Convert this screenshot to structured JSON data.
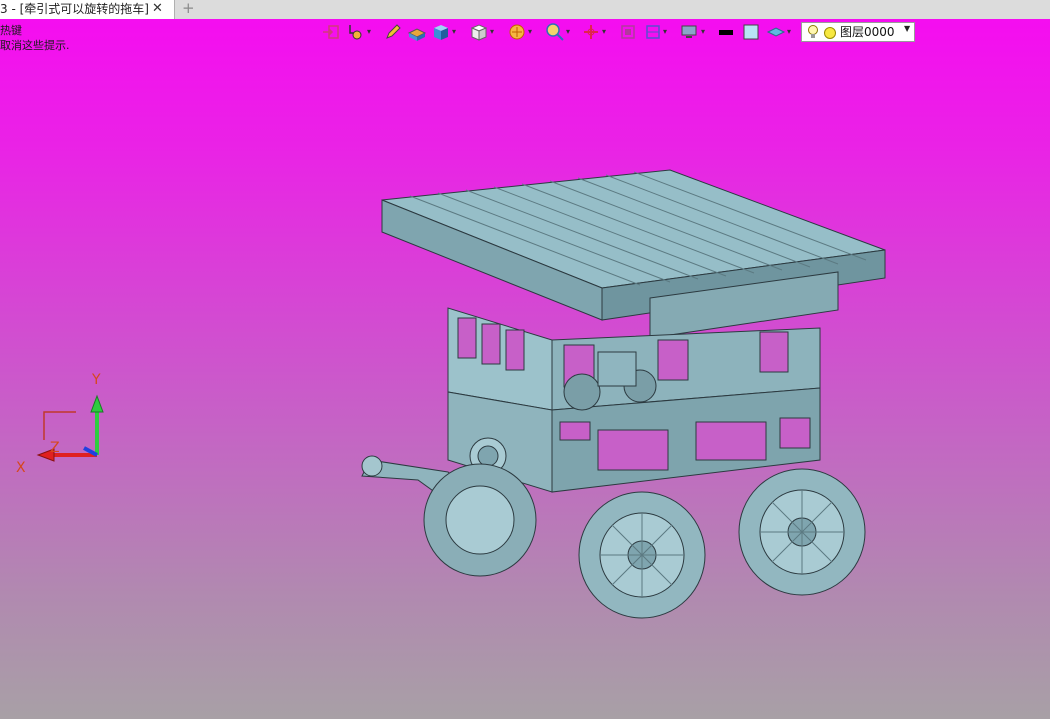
{
  "tab": {
    "title": "3 - [牵引式可以旋转的拖车]",
    "close_label": "✕",
    "new_tab_label": "+"
  },
  "hint": {
    "line1": "热键",
    "line2": "取消这些提示."
  },
  "toolbar": {
    "icons": [
      "exit-icon",
      "snap-icon",
      "pencil-icon",
      "material-icon",
      "solid-view-icon",
      "cube-view-icon",
      "render-icon",
      "zoom-icon",
      "rotate-icon",
      "fit-view-icon",
      "grid-icon",
      "display-icon",
      "line-color-icon",
      "fill-color-icon",
      "layer-visibility-icon"
    ]
  },
  "layer": {
    "name": "图层0000",
    "dropdown_arrow": "▼",
    "dot_color": "#f7e840"
  },
  "triad": {
    "x_label": "X",
    "y_label": "Y",
    "z_label": "Z"
  },
  "colors": {
    "viewport_top": "#f50df0",
    "viewport_bottom": "#a8a0a6",
    "model": "#8fb5bf"
  }
}
